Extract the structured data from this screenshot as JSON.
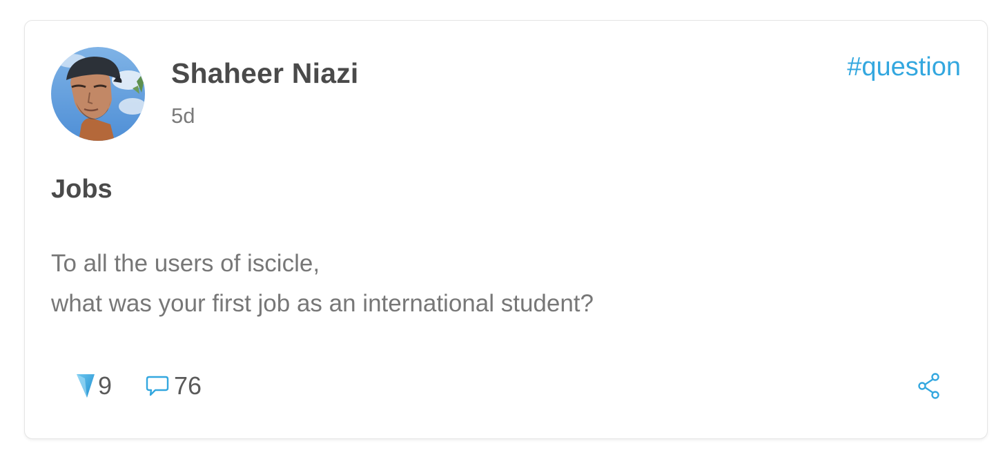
{
  "post": {
    "author": "Shaheer Niazi",
    "age": "5d",
    "tag": "#question",
    "title": "Jobs",
    "body_lines": [
      "To all the users of iscicle,",
      "what was your first job as an international student?"
    ],
    "upvotes": "9",
    "comments": "76"
  },
  "icons": {
    "upvote": "upvote-arrow-icon",
    "comment": "comment-bubble-icon",
    "share": "share-icon"
  },
  "colors": {
    "accent": "#33a7df",
    "text_primary": "#4a4a4a",
    "text_secondary": "#777777"
  }
}
